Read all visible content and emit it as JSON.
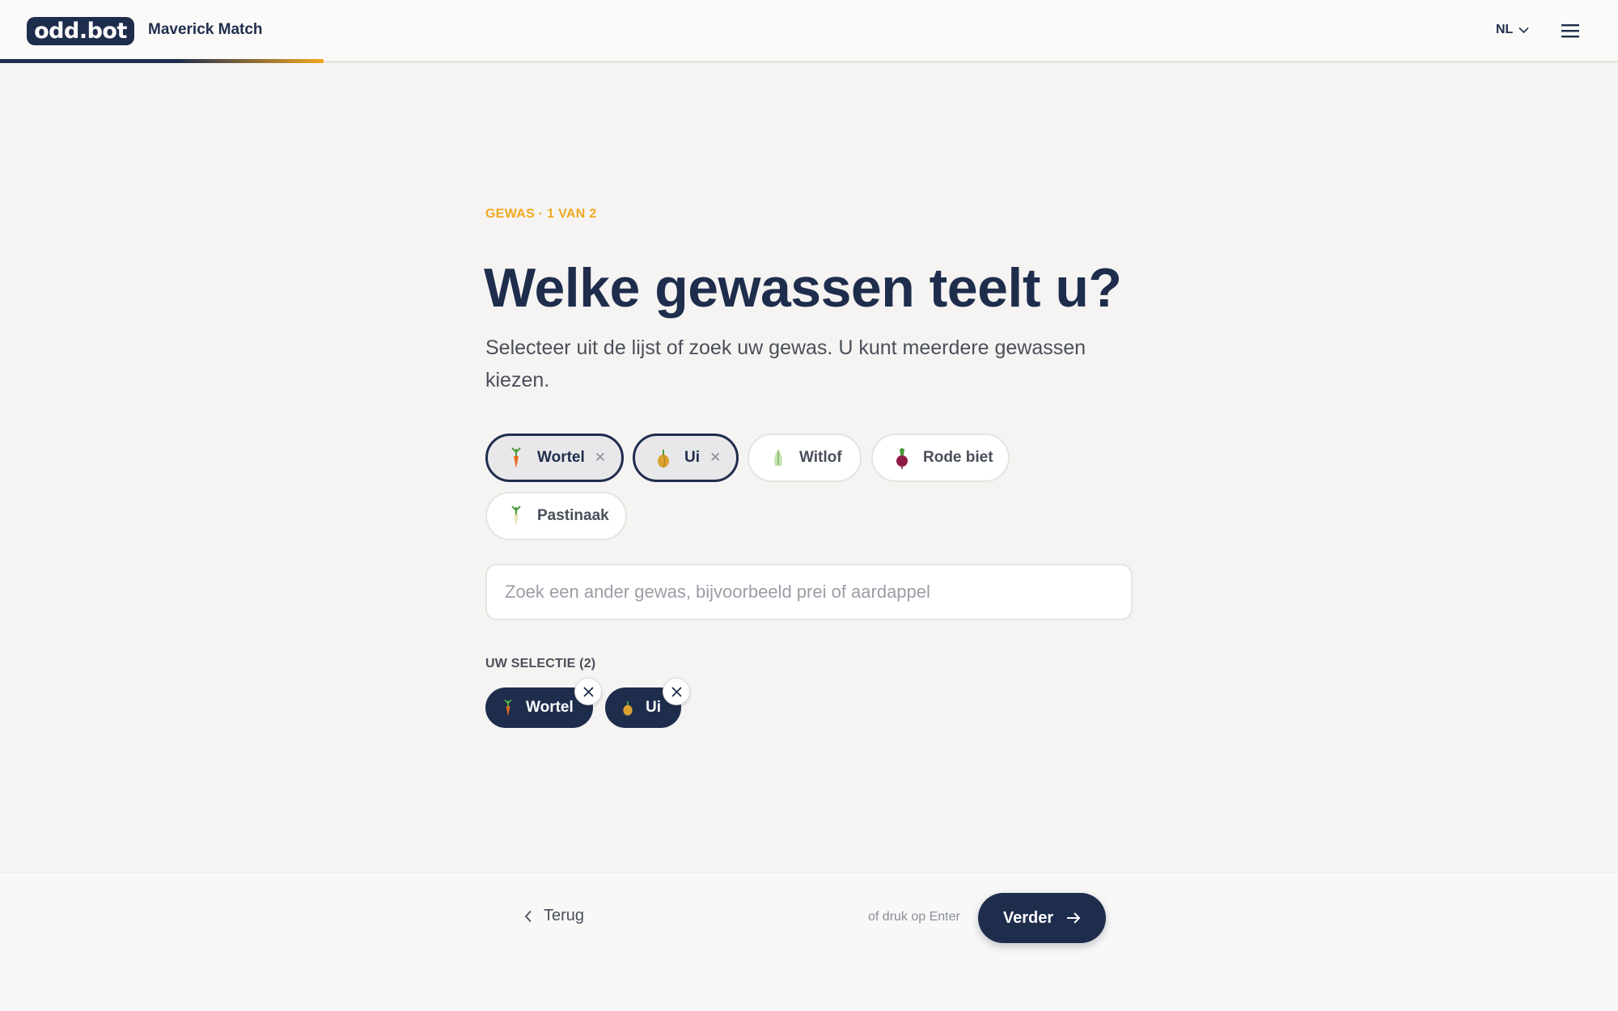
{
  "header": {
    "logo_text": "odd.bot",
    "app_title": "Maverick Match",
    "language": "NL",
    "progress": 0.2
  },
  "main": {
    "eyebrow": "GEWAS · 1 VAN 2",
    "heading": "Welke gewassen teelt u?",
    "subtitle": "Selecteer uit de lijst of zoek uw gewas. U kunt meerdere gewassen kiezen.",
    "crops": [
      {
        "label": "Wortel",
        "selected": true,
        "icon": "carrot-icon"
      },
      {
        "label": "Ui",
        "selected": true,
        "icon": "onion-icon"
      },
      {
        "label": "Witlof",
        "selected": false,
        "icon": "chicory-icon"
      },
      {
        "label": "Rode biet",
        "selected": false,
        "icon": "beetroot-icon"
      },
      {
        "label": "Pastinaak",
        "selected": false,
        "icon": "parsnip-icon"
      }
    ],
    "search_placeholder": "Zoek een ander gewas, bijvoorbeeld prei of aardappel",
    "selection_label": "UW SELECTIE (2)",
    "selection": [
      {
        "label": "Wortel",
        "icon": "carrot-icon"
      },
      {
        "label": "Ui",
        "icon": "onion-icon"
      }
    ]
  },
  "footer": {
    "back_label": "Terug",
    "hint": "of druk op Enter",
    "next_label": "Verder"
  },
  "colors": {
    "navy": "#1f2d4d",
    "accent": "#f0a823",
    "background": "#f5f4f2"
  }
}
